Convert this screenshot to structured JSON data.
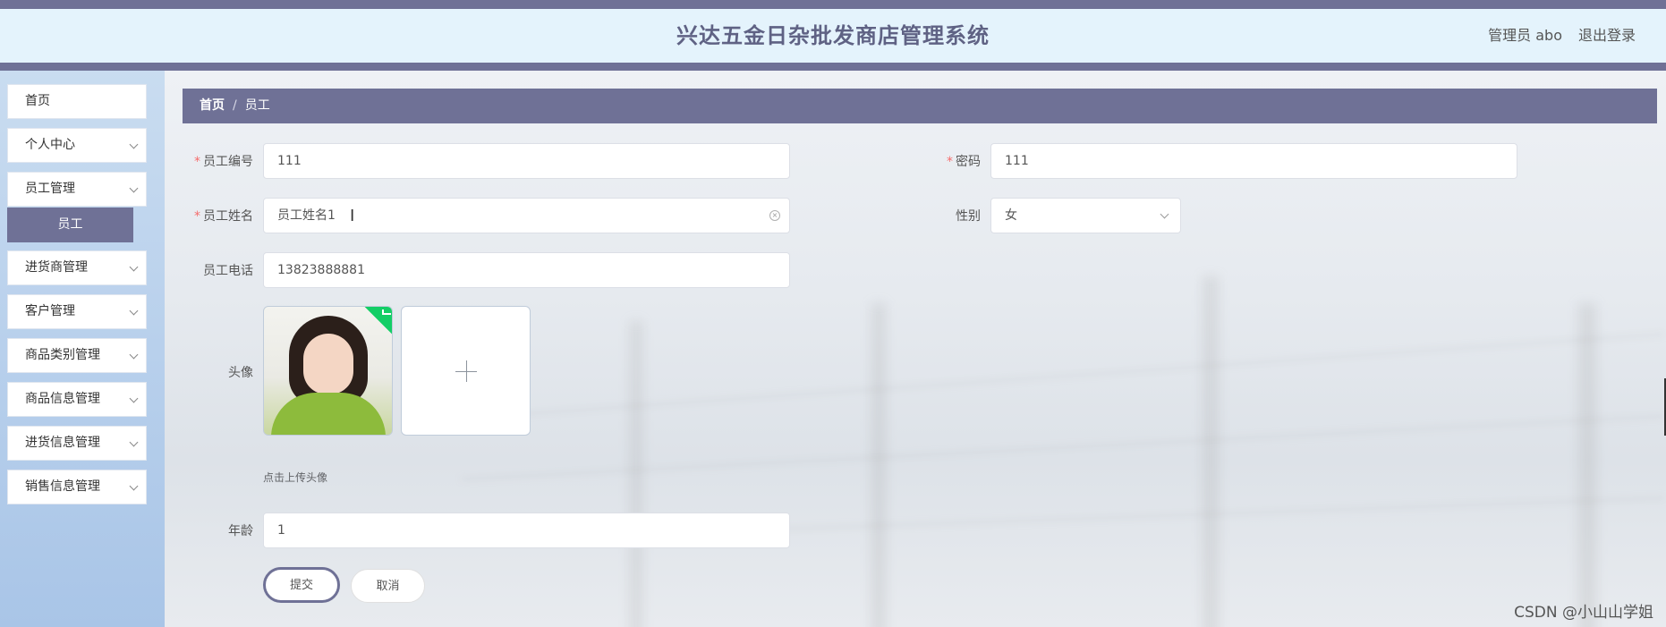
{
  "header": {
    "title": "兴达五金日杂批发商店管理系统",
    "user": "管理员 abo",
    "logout": "退出登录"
  },
  "sidebar": {
    "items": [
      {
        "label": "首页",
        "has_chevron": false
      },
      {
        "label": "个人中心",
        "has_chevron": true
      },
      {
        "label": "员工管理",
        "has_chevron": true
      },
      {
        "label": "进货商管理",
        "has_chevron": true
      },
      {
        "label": "客户管理",
        "has_chevron": true
      },
      {
        "label": "商品类别管理",
        "has_chevron": true
      },
      {
        "label": "商品信息管理",
        "has_chevron": true
      },
      {
        "label": "进货信息管理",
        "has_chevron": true
      },
      {
        "label": "销售信息管理",
        "has_chevron": true
      }
    ],
    "active_sub": "员工"
  },
  "breadcrumb": {
    "home": "首页",
    "separator": "/",
    "current": "员工"
  },
  "form": {
    "emp_no": {
      "label": "员工编号",
      "value": "111",
      "required": true
    },
    "password": {
      "label": "密码",
      "value": "111",
      "required": true
    },
    "emp_name": {
      "label": "员工姓名",
      "value": "员工姓名1",
      "required": true
    },
    "gender": {
      "label": "性别",
      "value": "女"
    },
    "phone": {
      "label": "员工电话",
      "value": "13823888881"
    },
    "avatar": {
      "label": "头像",
      "hint": "点击上传头像"
    },
    "age": {
      "label": "年龄",
      "value": "1"
    }
  },
  "buttons": {
    "submit": "提交",
    "cancel": "取消"
  },
  "watermark": "CSDN @小山山学姐",
  "colors": {
    "accent": "#6f7196",
    "header_bg": "#e4f3fc",
    "required": "#f56c6c",
    "success": "#13ce66"
  }
}
